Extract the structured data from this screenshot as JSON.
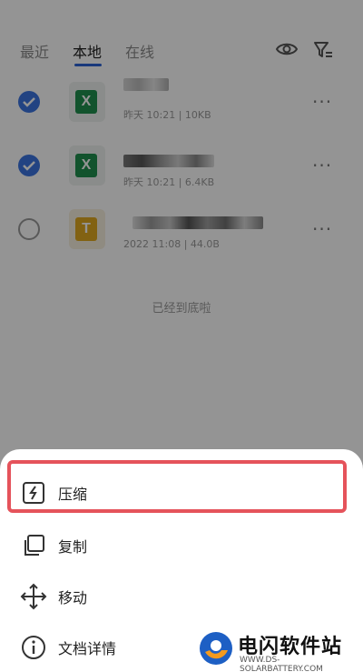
{
  "tabs": [
    {
      "label": "最近",
      "active": false
    },
    {
      "label": "本地",
      "active": true
    },
    {
      "label": "在线",
      "active": false
    }
  ],
  "files": [
    {
      "type": "excel",
      "icon_letter": "X",
      "selected": true,
      "meta": "昨天 10:21 | 10KB"
    },
    {
      "type": "excel",
      "icon_letter": "X",
      "selected": true,
      "meta": "昨天 10:21 | 6.4KB"
    },
    {
      "type": "text",
      "icon_letter": "T",
      "selected": false,
      "meta": "2022 11:08 | 44.0B"
    }
  ],
  "end_note": "已经到底啦",
  "sheet_menu": [
    {
      "label": "压缩",
      "icon": "compress-icon",
      "highlighted": true
    },
    {
      "label": "复制",
      "icon": "copy-icon"
    },
    {
      "label": "移动",
      "icon": "move-icon"
    },
    {
      "label": "文档详情",
      "icon": "info-icon"
    }
  ],
  "watermark": {
    "title": "电闪软件站",
    "subtitle": "WWW.DS-SOLARBATTERY.COM"
  },
  "colors": {
    "accent": "#2b63d6",
    "highlight": "#e5535b",
    "excel": "#1f8f4f",
    "text_file": "#e0a920"
  }
}
